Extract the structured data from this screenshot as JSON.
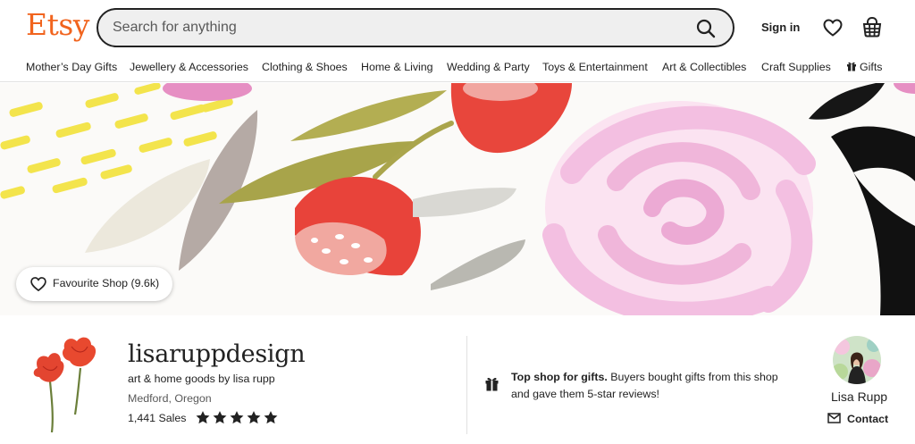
{
  "header": {
    "logo": "Etsy",
    "search_placeholder": "Search for anything",
    "signin_label": "Sign in"
  },
  "nav": {
    "items": [
      "Mother’s Day Gifts",
      "Jewellery & Accessories",
      "Clothing & Shoes",
      "Home & Living",
      "Wedding & Party",
      "Toys & Entertainment",
      "Art & Collectibles",
      "Craft Supplies",
      "Gifts"
    ]
  },
  "banner": {
    "favourite_label": "Favourite Shop (9.6k)"
  },
  "shop": {
    "name": "lisaruppdesign",
    "tagline": "art & home goods by lisa rupp",
    "location": "Medford, Oregon",
    "sales": "1,441 Sales",
    "rating_stars": 5
  },
  "top_shop": {
    "title": "Top shop for gifts.",
    "text": "Buyers bought gifts from this shop and gave them 5-star reviews!"
  },
  "owner": {
    "name": "Lisa Rupp",
    "contact_label": "Contact"
  },
  "colors": {
    "brand": "#f1641e",
    "text": "#222222",
    "search_bg": "#efefef"
  },
  "icons": {
    "search": "search-icon",
    "favourites": "heart-icon",
    "cart": "shopping-basket-icon",
    "gift": "gift-icon",
    "contact": "mail-icon"
  }
}
